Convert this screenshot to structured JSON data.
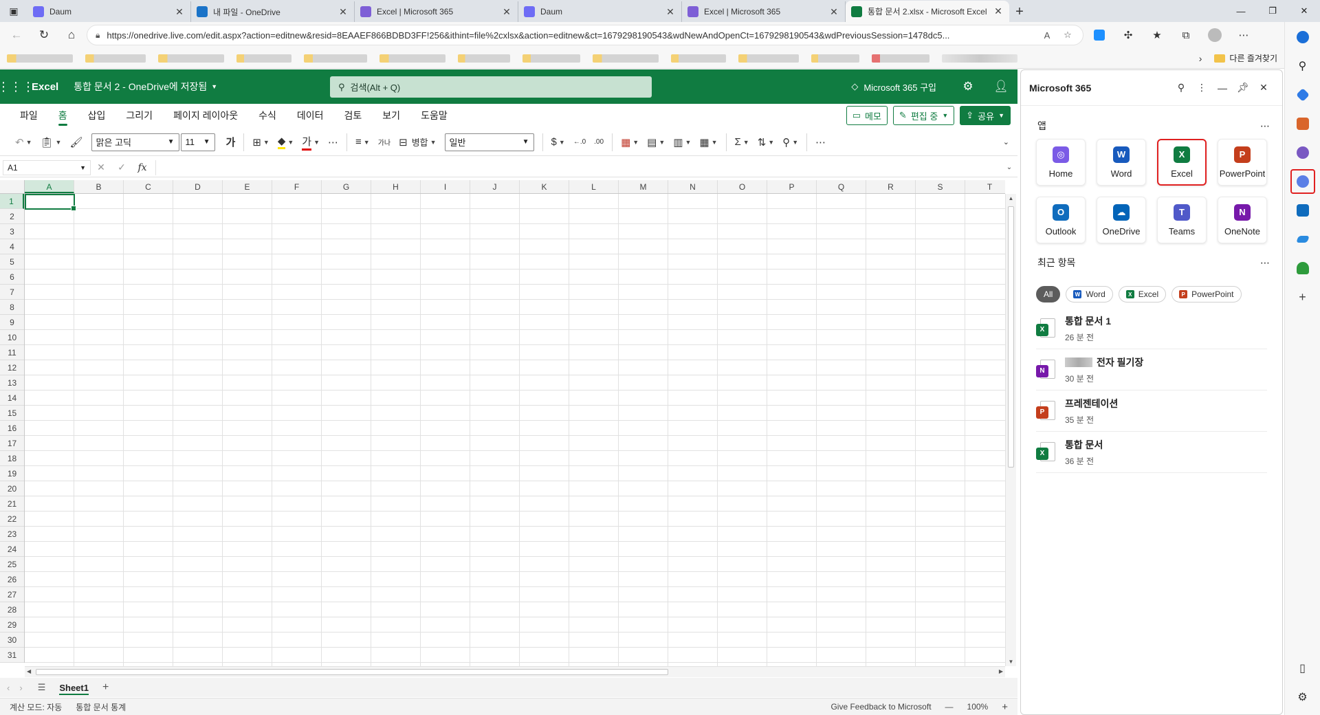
{
  "browser": {
    "tabs": [
      {
        "title": "Daum",
        "icon": "daum-icon",
        "color": "#6e6cf5"
      },
      {
        "title": "내 파일 - OneDrive",
        "icon": "onedrive-icon",
        "color": "#1a73c8"
      },
      {
        "title": "Excel | Microsoft 365",
        "icon": "m365-icon",
        "color": "#7e5fd6"
      },
      {
        "title": "Daum",
        "icon": "daum-icon",
        "color": "#6e6cf5"
      },
      {
        "title": "Excel | Microsoft 365",
        "icon": "m365-icon",
        "color": "#7e5fd6"
      },
      {
        "title": "통합 문서 2.xlsx - Microsoft Excel",
        "icon": "excel-icon",
        "color": "#107c41",
        "active": true
      }
    ],
    "url": "https://onedrive.live.com/edit.aspx?action=editnew&resid=8EAAEF866BDBD3FF!256&ithint=file%2cxlsx&action=editnew&ct=1679298190543&wdNewAndOpenCt=1679298190543&wdPreviousSession=1478dc5...",
    "other_favorites": "다른 즐겨찾기"
  },
  "excel": {
    "app_name": "Excel",
    "doc_title": "통합 문서 2 - OneDrive에 저장됨",
    "search_placeholder": "검색(Alt + Q)",
    "buy_label": "Microsoft 365 구입",
    "ribbon_tabs": [
      "파일",
      "홈",
      "삽입",
      "그리기",
      "페이지 레이아웃",
      "수식",
      "데이터",
      "검토",
      "보기",
      "도움말"
    ],
    "active_ribbon_tab": "홈",
    "memo_label": "메모",
    "edit_label": "편집 중",
    "share_label": "공유",
    "font_name": "맑은 고딕",
    "font_size": "11",
    "bold_glyph": "가",
    "fill_glyph": "가",
    "wrap_glyph": "가나",
    "merge_label": "병합",
    "number_format": "일반",
    "currency_glyph": "$",
    "dec_inc": ".00",
    "name_box": "A1",
    "fx_label": "fx",
    "columns": [
      "A",
      "B",
      "C",
      "D",
      "E",
      "F",
      "G",
      "H",
      "I",
      "J",
      "K",
      "L",
      "M",
      "N",
      "O",
      "P",
      "Q",
      "R",
      "S",
      "T"
    ],
    "rows": [
      "1",
      "2",
      "3",
      "4",
      "5",
      "6",
      "7",
      "8",
      "9",
      "10",
      "11",
      "12",
      "13",
      "14",
      "15",
      "16",
      "17",
      "18",
      "19",
      "20",
      "21",
      "22",
      "23",
      "24",
      "25",
      "26",
      "27",
      "28",
      "29",
      "30",
      "31"
    ],
    "active_cell": "A1",
    "sheet_tab": "Sheet1",
    "status_calc": "계산 모드: 자동",
    "status_stats": "통합 문서 통계",
    "feedback": "Give Feedback to Microsoft",
    "zoom": "100%",
    "brand_color": "#107c41"
  },
  "m365_panel": {
    "title": "Microsoft 365",
    "apps_heading": "앱",
    "apps": [
      {
        "label": "Home",
        "icon": "m365-home-icon",
        "color": "#7b5be6",
        "glyph": "◎"
      },
      {
        "label": "Word",
        "icon": "word-icon",
        "color": "#185abd",
        "glyph": "W"
      },
      {
        "label": "Excel",
        "icon": "excel-icon",
        "color": "#107c41",
        "glyph": "X",
        "highlight": true
      },
      {
        "label": "PowerPoint",
        "icon": "powerpoint-icon",
        "color": "#c43e1c",
        "glyph": "P"
      },
      {
        "label": "Outlook",
        "icon": "outlook-icon",
        "color": "#0f6cbd",
        "glyph": "O"
      },
      {
        "label": "OneDrive",
        "icon": "onedrive-icon",
        "color": "#0364b8",
        "glyph": "☁"
      },
      {
        "label": "Teams",
        "icon": "teams-icon",
        "color": "#5059c9",
        "glyph": "T"
      },
      {
        "label": "OneNote",
        "icon": "onenote-icon",
        "color": "#7719aa",
        "glyph": "N"
      }
    ],
    "recent_heading": "최근 항목",
    "filters": [
      {
        "label": "All",
        "active": true
      },
      {
        "label": "Word",
        "color": "#185abd",
        "glyph": "W"
      },
      {
        "label": "Excel",
        "color": "#107c41",
        "glyph": "X"
      },
      {
        "label": "PowerPoint",
        "color": "#c43e1c",
        "glyph": "P"
      }
    ],
    "recent": [
      {
        "name": "통합 문서 1",
        "time": "26 분 전",
        "color": "#107c41",
        "glyph": "X"
      },
      {
        "name": "전자 필기장",
        "time": "30 분 전",
        "color": "#7719aa",
        "glyph": "N",
        "redacted_prefix": true
      },
      {
        "name": "프레젠테이션",
        "time": "35 분 전",
        "color": "#c43e1c",
        "glyph": "P"
      },
      {
        "name": "통합 문서",
        "time": "36 분 전",
        "color": "#107c41",
        "glyph": "X"
      }
    ]
  }
}
